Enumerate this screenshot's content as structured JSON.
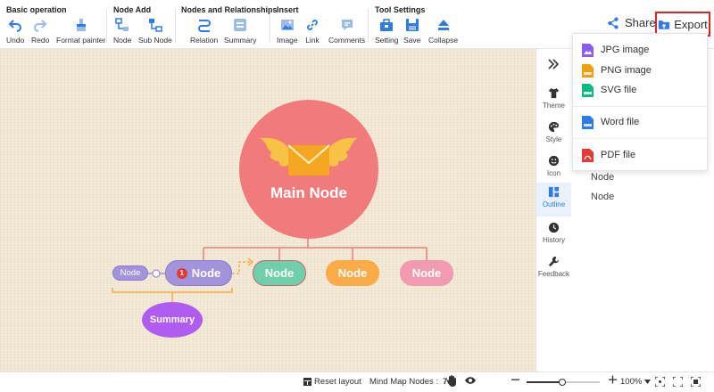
{
  "toolbar": {
    "groups": [
      {
        "title": "Basic operation",
        "tools": [
          "Undo",
          "Redo",
          "Format painter"
        ]
      },
      {
        "title": "Node Add",
        "tools": [
          "Node",
          "Sub Node"
        ]
      },
      {
        "title": "Nodes and Relationships",
        "tools": [
          "Relation",
          "Summary"
        ]
      },
      {
        "title": "Insert",
        "tools": [
          "Image",
          "Link",
          "Comments"
        ]
      },
      {
        "title": "Tool Settings",
        "tools": [
          "Setting",
          "Save",
          "Collapse"
        ]
      }
    ],
    "share_label": "Share",
    "export_label": "Export"
  },
  "export_menu": [
    {
      "label": "JPG image",
      "icon": "jpg-file-icon",
      "color": "#8b5cf6"
    },
    {
      "label": "PNG image",
      "icon": "png-file-icon",
      "color": "#f59e0b"
    },
    {
      "label": "SVG file",
      "icon": "svg-file-icon",
      "color": "#10b981"
    },
    {
      "label": "Word file",
      "icon": "word-file-icon",
      "color": "#2f7ce8"
    },
    {
      "label": "PDF file",
      "icon": "pdf-file-icon",
      "color": "#e53935"
    }
  ],
  "sidebar": {
    "items": [
      {
        "label": "Theme",
        "icon": "shirt-icon"
      },
      {
        "label": "Style",
        "icon": "palette-icon"
      },
      {
        "label": "Icon",
        "icon": "smiley-icon"
      },
      {
        "label": "Outline",
        "icon": "outline-icon",
        "active": true
      },
      {
        "label": "History",
        "icon": "clock-icon"
      },
      {
        "label": "Feedback",
        "icon": "wrench-icon"
      }
    ]
  },
  "outline": {
    "items": [
      "Node",
      "Node"
    ]
  },
  "mindmap": {
    "main_node": "Main Node",
    "left_node": "Node",
    "badge": "1",
    "children": [
      "Node",
      "Node",
      "Node",
      "Node"
    ],
    "summary": "Summary"
  },
  "colors": {
    "main": "#f17b7b",
    "child_purple": "#a293dc",
    "child_green": "#6fcfaa",
    "child_orange": "#fbab47",
    "child_pink": "#f29bb0",
    "summary": "#b05cf0",
    "export_border": "#d9262c",
    "accent": "#2f7ce8"
  },
  "statusbar": {
    "reset_label": "Reset layout",
    "nodes_label": "Mind Map Nodes :",
    "nodes_count": "7",
    "zoom": "100%"
  }
}
